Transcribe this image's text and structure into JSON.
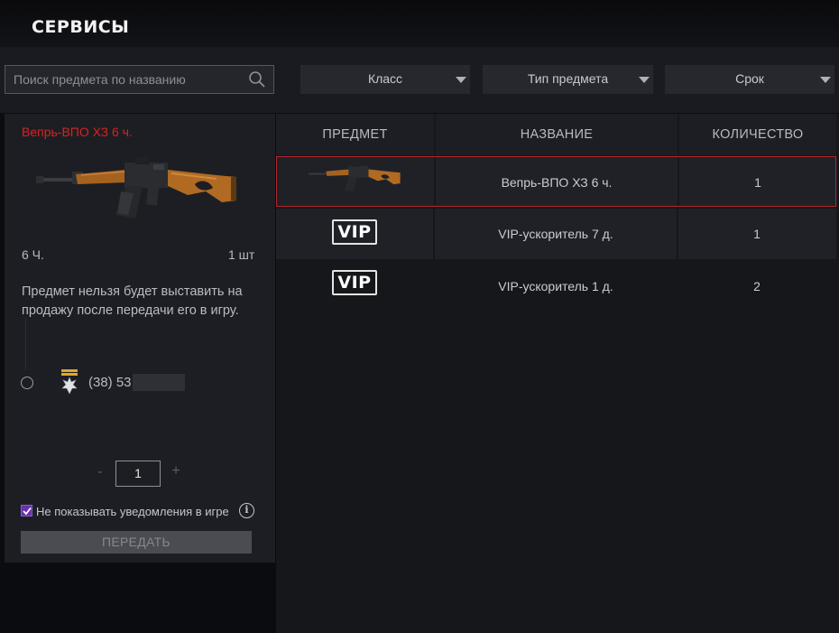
{
  "header": {
    "title": "СЕРВИСЫ"
  },
  "search": {
    "placeholder": "Поиск предмета по названию"
  },
  "filters": [
    {
      "label": "Класс"
    },
    {
      "label": "Тип предмета"
    },
    {
      "label": "Срок"
    }
  ],
  "detail": {
    "item_name": "Вепрь-ВПО ХЗ 6 ч.",
    "duration": "6 Ч.",
    "quantity": "1 шт",
    "note": "Предмет нельзя будет выставить на продажу после передачи его в игру.",
    "player": "(38) 53",
    "stepper_minus": "-",
    "stepper_value": "1",
    "stepper_plus": "+",
    "checkbox_label": "Не показывать уведомления в игре",
    "checkbox_checked": true,
    "info_glyph": "i",
    "transfer_button": "ПЕРЕДАТЬ"
  },
  "table": {
    "headers": [
      "ПРЕДМЕТ",
      "НАЗВАНИЕ",
      "КОЛИЧЕСТВО"
    ],
    "rows": [
      {
        "icon": "rifle-icon",
        "name": "Вепрь-ВПО ХЗ 6 ч.",
        "count": "1",
        "selected": true
      },
      {
        "icon": "vip-icon",
        "badge": "VIP",
        "name": "VIP-ускоритель 7 д.",
        "count": "1"
      },
      {
        "icon": "vip-icon",
        "badge": "VIP",
        "name": "VIP-ускоритель 1 д.",
        "count": "2"
      }
    ]
  },
  "colors": {
    "accent_red": "#d92222",
    "selected_border": "#b3272a",
    "checkbox_purple": "#6b2fb0",
    "background": "#0b0c0f"
  }
}
